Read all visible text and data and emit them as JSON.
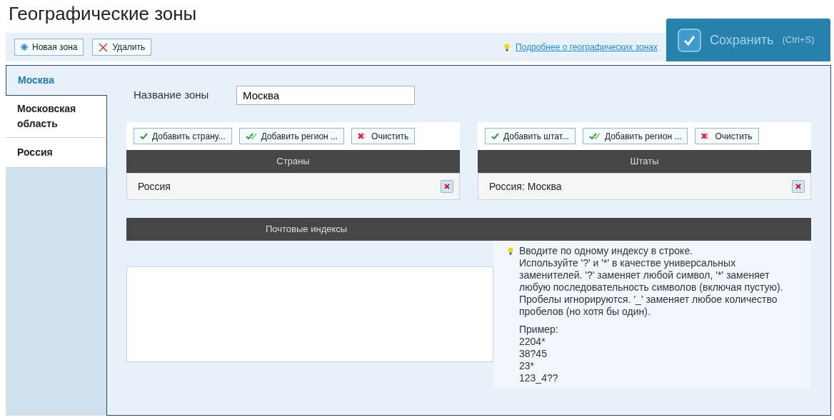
{
  "title": "Географические зоны",
  "toolbar": {
    "buttons": [
      {
        "label": "Новая зона",
        "kind": "new"
      },
      {
        "label": "Удалить",
        "kind": "delete"
      }
    ],
    "help_link": "Подробнее о географических зонах"
  },
  "save": {
    "label": "Сохранить",
    "shortcut": "(Ctrl+S)"
  },
  "zones": [
    {
      "name": "Москва",
      "selected": true
    },
    {
      "name": "Московская область",
      "selected": false
    },
    {
      "name": "Россия",
      "selected": false
    }
  ],
  "zone_name": {
    "label": "Название зоны",
    "value": "Москва"
  },
  "panels": [
    {
      "buttons": [
        {
          "label": "Добавить страну...",
          "kind": "add"
        },
        {
          "label": "Добавить регион ...",
          "kind": "add_region"
        },
        {
          "label": "Очистить",
          "kind": "clear"
        }
      ],
      "header": "Страны",
      "items": [
        "Россия"
      ]
    },
    {
      "buttons": [
        {
          "label": "Добавить штат...",
          "kind": "add"
        },
        {
          "label": "Добавить регион ...",
          "kind": "add_region"
        },
        {
          "label": "Очистить",
          "kind": "clear"
        }
      ],
      "header": "Штаты",
      "items": [
        "Россия: Москва"
      ]
    }
  ],
  "postal": {
    "header": "Почтовые индексы",
    "hint": "Вводите по одному индексу в строке.",
    "details": "Используйте '?' и '*' в качестве универсальных заменителей. '?' заменяет любой символ, '*' заменяет любую последовательность символов (включая пустую). Пробелы игнорируются. '_' заменяет любое количество пробелов (но хотя бы один).",
    "example_label": "Пример:",
    "examples": [
      "2204*",
      "38?45",
      "23*",
      "123_4??"
    ]
  }
}
